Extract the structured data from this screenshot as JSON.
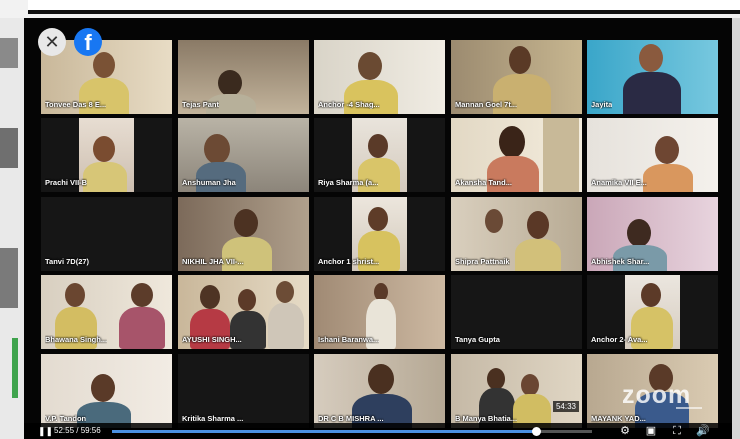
{
  "player": {
    "time_display": "52:55 / 59:56",
    "progress": 0.883,
    "meeting_clock": "54:33",
    "watermark": "zoom",
    "play_state_icon": "pause-icon"
  },
  "overlay": {
    "close_glyph": "✕",
    "facebook_glyph": "f"
  },
  "controls": {
    "play_glyph": "❚❚",
    "settings_glyph": "⚙",
    "fullscreen_glyph": "⛶",
    "pip_glyph": "▣",
    "volume_glyph": "🔊"
  },
  "participants": [
    {
      "name": "Tonvee Das 8 E..."
    },
    {
      "name": "Tejas Pant"
    },
    {
      "name": "Anchor -4 Shag..."
    },
    {
      "name": "Mannan Goel 7t..."
    },
    {
      "name": "Jayita"
    },
    {
      "name": "Prachi VII-B"
    },
    {
      "name": "Anshuman Jha"
    },
    {
      "name": "Riya Sharma (a..."
    },
    {
      "name": "Akansha Tand..."
    },
    {
      "name": "Anamika VII E..."
    },
    {
      "name": "Tanvi 7D(27)"
    },
    {
      "name": "NIKHIL JHA VII-..."
    },
    {
      "name": "Anchor 1 shrist..."
    },
    {
      "name": "Shipra Pattnaik"
    },
    {
      "name": "Abhishek Shar..."
    },
    {
      "name": "Bhawana Singh..."
    },
    {
      "name": "AYUSHI SINGH..."
    },
    {
      "name": "Ishani Baranwa..."
    },
    {
      "name": "Tanya Gupta"
    },
    {
      "name": "Anchor 2- Ava..."
    },
    {
      "name": "V.P. Tandon"
    },
    {
      "name": "Kritika Sharma ..."
    },
    {
      "name": "DR C B MISHRA ..."
    },
    {
      "name": "B Manya Bhatia..."
    },
    {
      "name": "MAYANK YAD..."
    }
  ],
  "colors": {
    "active_speaker": "#7ed321",
    "progress_fill": "#4a90e2",
    "facebook": "#1877f2"
  }
}
